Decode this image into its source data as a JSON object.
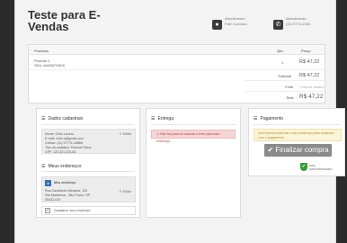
{
  "header": {
    "title": "Teste para E-Vendas",
    "contact_chat": {
      "line1": "Atendimento",
      "line2": "Fale Conosco"
    },
    "contact_phone": {
      "line1": "Atendimento",
      "line2": "(11) 9774-1000"
    }
  },
  "cart": {
    "headers": {
      "product": "Produtos",
      "qty": "Qtd.",
      "price": "Preço"
    },
    "item": {
      "name": "Produto 1",
      "sku": "SKU: A44567X5X6",
      "qty": "1",
      "price": "R$ 47,22"
    },
    "subtotal": {
      "label": "Subtotal",
      "value": "R$ 47,22"
    },
    "shipping": {
      "label": "Frete",
      "value": "Calcule abaixo"
    },
    "total": {
      "label": "Total",
      "value": "R$ 47,22"
    }
  },
  "personal": {
    "title": "Dados cadastrais",
    "edit": "Editar",
    "name": "Nome: Chris Lucero",
    "email": "E-mail: chris.n@gmail.com",
    "phone": "Celular: (11) 97774-16868",
    "person_type": "Tipo de cadastro: Pessoa Física",
    "cpf": "CPF: 123.321.220-84"
  },
  "addresses": {
    "title": "Meus endereços",
    "selected_name": "Meu endereço",
    "edit": "Editar",
    "line1": "Rua Cavalheiro Messina, 103",
    "line2": "Vila Madalena - São Paulo / SP",
    "line3": "05432-010",
    "add_label": "Cadastrar novo endereço"
  },
  "delivery": {
    "title": "Entrega",
    "alert": "Não foi possível calcular o frete para este endereço."
  },
  "payment": {
    "title": "Pagamento",
    "alert": "Você precisa informar o seu endereço para continuar com o pagamento.",
    "button": "Finalizar compra",
    "seal_line1": "SITE",
    "seal_line2": "SITE PROTEGIDO"
  },
  "colors": {
    "finalize_button": "#8a8a8a",
    "alert_red_bg": "#f5d5d5",
    "alert_yellow_bg": "#fcf4d9",
    "seal_green": "#3a9b3a"
  }
}
